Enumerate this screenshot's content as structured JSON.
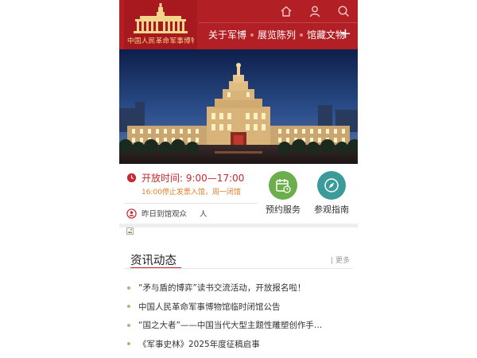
{
  "brand": {
    "logo_text": "中国人民革命军事博物馆"
  },
  "header": {
    "icons": [
      "home-icon",
      "user-icon",
      "search-icon"
    ],
    "nav": [
      "关于军博",
      "展览陈列",
      "馆藏文物"
    ],
    "more_symbol": "+"
  },
  "info": {
    "open_time": "开放时间: 9:00—17:00",
    "open_note": "16:00停止发票入馆，周一闭馆",
    "visitor_label": "昨日到馆观众",
    "visitor_unit": "人"
  },
  "services": [
    {
      "label": "预约服务",
      "icon": "calendar-icon",
      "color": "#6cad4c"
    },
    {
      "label": "参观指南",
      "icon": "compass-icon",
      "color": "#3b9b9a"
    }
  ],
  "news": {
    "title": "资讯动态",
    "more": "| 更多",
    "items": [
      "“矛与盾的博弈”读书交流活动，开放报名啦！",
      "中国人民革命军事博物馆临时闭馆公告",
      "“国之大者”——中国当代大型主题性雕塑创作手…",
      "《军事史林》2025年度征稿启事"
    ]
  },
  "colors": {
    "brand_red": "#b21f24",
    "accent_orange": "#e07f2b",
    "gold": "#f3d48c"
  }
}
